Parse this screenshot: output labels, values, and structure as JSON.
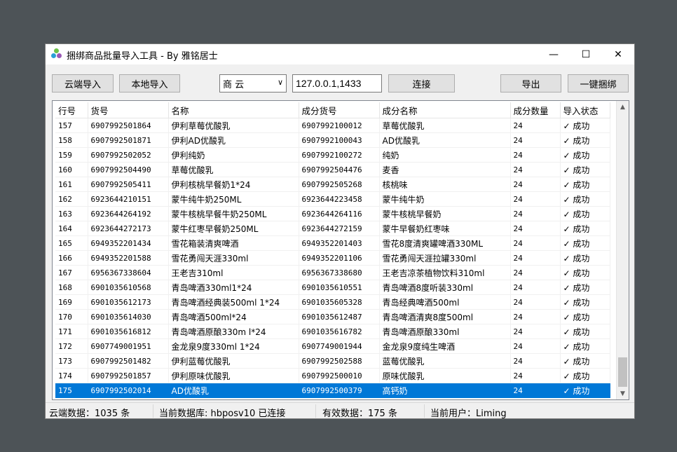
{
  "window": {
    "title": "捆绑商品批量导入工具 - By 雅铭居士"
  },
  "toolbar": {
    "cloud_import": "云端导入",
    "local_import": "本地导入",
    "db_select_value": "商 云",
    "server_value": "127.0.0.1,1433",
    "connect": "连接",
    "export": "导出",
    "bind_all": "一键捆绑"
  },
  "table": {
    "headers": [
      "行号",
      "货号",
      "名称",
      "成分货号",
      "成分名称",
      "成分数量",
      "导入状态"
    ],
    "rows": [
      [
        "157",
        "6907992501864",
        "伊利草莓优酸乳",
        "6907992100012",
        "草莓优酸乳",
        "24",
        "✓ 成功"
      ],
      [
        "158",
        "6907992501871",
        "伊利AD优酸乳",
        "6907992100043",
        "AD优酸乳",
        "24",
        "✓ 成功"
      ],
      [
        "159",
        "6907992502052",
        "伊利纯奶",
        "6907992100272",
        "纯奶",
        "24",
        "✓ 成功"
      ],
      [
        "160",
        "6907992504490",
        "草莓优酸乳",
        "6907992504476",
        "麦香",
        "24",
        "✓ 成功"
      ],
      [
        "161",
        "6907992505411",
        "伊利核桃早餐奶1*24",
        "6907992505268",
        "核桃味",
        "24",
        "✓ 成功"
      ],
      [
        "162",
        "6923644210151",
        "蒙牛纯牛奶250ML",
        "6923644223458",
        "蒙牛纯牛奶",
        "24",
        "✓ 成功"
      ],
      [
        "163",
        "6923644264192",
        "蒙牛核桃早餐牛奶250ML",
        "6923644264116",
        "蒙牛核桃早餐奶",
        "24",
        "✓ 成功"
      ],
      [
        "164",
        "6923644272173",
        "蒙牛红枣早餐奶250ML",
        "6923644272159",
        "蒙牛早餐奶红枣味",
        "24",
        "✓ 成功"
      ],
      [
        "165",
        "6949352201434",
        "雪花箱装清爽啤酒",
        "6949352201403",
        "雪花8度清爽罐啤酒330ML",
        "24",
        "✓ 成功"
      ],
      [
        "166",
        "6949352201588",
        "雪花勇闯天涯330ml",
        "6949352201106",
        "雪花勇闯天涯拉罐330ml",
        "24",
        "✓ 成功"
      ],
      [
        "167",
        "6956367338604",
        "王老吉310ml",
        "6956367338680",
        "王老吉凉茶植物饮料310ml",
        "24",
        "✓ 成功"
      ],
      [
        "168",
        "6901035610568",
        "青岛啤酒330ml1*24",
        "6901035610551",
        "青岛啤酒8度听装330ml",
        "24",
        "✓ 成功"
      ],
      [
        "169",
        "6901035612173",
        "青岛啤酒经典装500ml 1*24",
        "6901035605328",
        "青岛经典啤酒500ml",
        "24",
        "✓ 成功"
      ],
      [
        "170",
        "6901035614030",
        "青岛啤酒500ml*24",
        "6901035612487",
        "青岛啤酒清爽8度500ml",
        "24",
        "✓ 成功"
      ],
      [
        "171",
        "6901035616812",
        "青岛啤酒原酿330m l*24",
        "6901035616782",
        "青岛啤酒原酿330ml",
        "24",
        "✓ 成功"
      ],
      [
        "172",
        "6907749001951",
        "金龙泉9度330ml  1*24",
        "6907749001944",
        "金龙泉9度纯生啤酒",
        "24",
        "✓ 成功"
      ],
      [
        "173",
        "6907992501482",
        "伊利蓝莓优酸乳",
        "6907992502588",
        "蓝莓优酸乳",
        "24",
        "✓ 成功"
      ],
      [
        "174",
        "6907992501857",
        "伊利原味优酸乳",
        "6907992500010",
        "原味优酸乳",
        "24",
        "✓ 成功"
      ],
      [
        "175",
        "6907992502014",
        "AD优酸乳",
        "6907992500379",
        "高钙奶",
        "24",
        "✓ 成功"
      ]
    ],
    "selected_row": 18
  },
  "status": {
    "cloud_count": "云端数据：1035 条",
    "current_db": "当前数据库: hbposv10 已连接",
    "valid_count": "有效数据：175 条",
    "current_user": "当前用户：Liming"
  },
  "colors": {
    "selection": "#0078d7",
    "background": "#4d5357"
  },
  "icons": {
    "app": "app-logo-icon",
    "minimize": "minimize-icon",
    "maximize": "maximize-icon",
    "close": "close-icon"
  }
}
